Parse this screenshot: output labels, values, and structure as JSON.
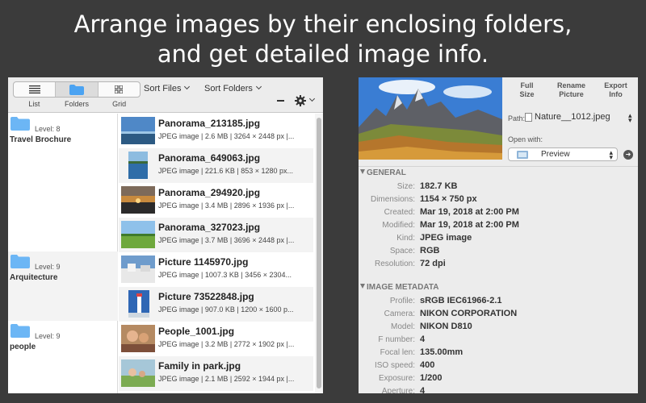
{
  "headline": {
    "line1": "Arrange images by their enclosing folders,",
    "line2": "and get detailed image info."
  },
  "left_window": {
    "view_modes": [
      {
        "label": "List",
        "icon": "list-icon"
      },
      {
        "label": "Folders",
        "icon": "folder-icon",
        "active": true
      },
      {
        "label": "Grid",
        "icon": "grid-icon"
      }
    ],
    "sort_files_label": "Sort Files",
    "sort_folders_label": "Sort Folders",
    "folders": [
      {
        "level": "Level: 8",
        "name": "Travel Brochure"
      },
      {
        "level": "Level: 9",
        "name": "Arquitecture"
      },
      {
        "level": "Level: 9",
        "name": "people"
      }
    ],
    "files": [
      {
        "name": "Panorama_213185.jpg",
        "info": "JPEG image | 2.6 MB | 3264 × 2448 px |..."
      },
      {
        "name": "Panorama_649063.jpg",
        "info": "JPEG image | 221.6 KB | 853 × 1280 px..."
      },
      {
        "name": "Panorama_294920.jpg",
        "info": "JPEG image | 3.4 MB | 2896 × 1936 px |..."
      },
      {
        "name": "Panorama_327023.jpg",
        "info": "JPEG image | 3.7 MB | 3696 × 2448 px |..."
      },
      {
        "name": "Picture 1145970.jpg",
        "info": "JPEG image | 1007.3 KB | 3456 × 2304..."
      },
      {
        "name": "Picture 73522848.jpg",
        "info": "JPEG image | 907.0 KB | 1200 × 1600 p..."
      },
      {
        "name": "People_1001.jpg",
        "info": "JPEG image | 3.2 MB | 2772 × 1902 px |..."
      },
      {
        "name": "Family in park.jpg",
        "info": "JPEG image | 2.1 MB | 2592 × 1944 px |..."
      }
    ]
  },
  "right_window": {
    "buttons": [
      {
        "line1": "Full",
        "line2": "Size"
      },
      {
        "line1": "Rename",
        "line2": "Picture"
      },
      {
        "line1": "Export",
        "line2": "Info"
      }
    ],
    "path_label": "Path:",
    "path_value": "Nature__1012.jpeg",
    "open_with_label": "Open with:",
    "open_with_app": "Preview",
    "general_title": "GENERAL",
    "general": [
      {
        "key": "Size:",
        "value": "182.7 KB"
      },
      {
        "key": "Dimensions:",
        "value": "1154 × 750 px"
      },
      {
        "key": "Created:",
        "value": "Mar 19, 2018 at 2:00 PM"
      },
      {
        "key": "Modified:",
        "value": "Mar 19, 2018 at 2:00 PM"
      },
      {
        "key": "Kind:",
        "value": "JPEG image"
      },
      {
        "key": "Space:",
        "value": "RGB"
      },
      {
        "key": "Resolution:",
        "value": "72 dpi"
      }
    ],
    "metadata_title": "IMAGE METADATA",
    "metadata": [
      {
        "key": "Profile:",
        "value": "sRGB IEC61966-2.1"
      },
      {
        "key": "Camera:",
        "value": "NIKON CORPORATION"
      },
      {
        "key": "Model:",
        "value": "NIKON D810"
      },
      {
        "key": "F number:",
        "value": "4"
      },
      {
        "key": "Focal len:",
        "value": "135.00mm"
      },
      {
        "key": "ISO speed:",
        "value": "400"
      },
      {
        "key": "Exposure:",
        "value": "1/200"
      },
      {
        "key": "Aperture:",
        "value": "4"
      }
    ]
  }
}
